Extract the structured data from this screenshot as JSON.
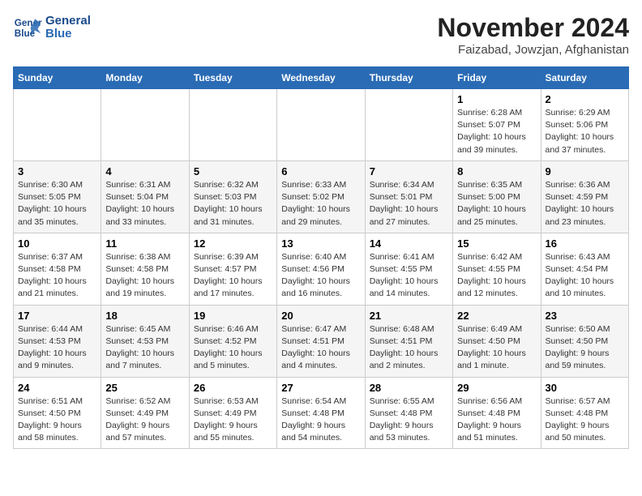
{
  "logo": {
    "line1": "General",
    "line2": "Blue"
  },
  "title": "November 2024",
  "subtitle": "Faizabad, Jowzjan, Afghanistan",
  "weekdays": [
    "Sunday",
    "Monday",
    "Tuesday",
    "Wednesday",
    "Thursday",
    "Friday",
    "Saturday"
  ],
  "weeks": [
    [
      {
        "day": "",
        "info": ""
      },
      {
        "day": "",
        "info": ""
      },
      {
        "day": "",
        "info": ""
      },
      {
        "day": "",
        "info": ""
      },
      {
        "day": "",
        "info": ""
      },
      {
        "day": "1",
        "info": "Sunrise: 6:28 AM\nSunset: 5:07 PM\nDaylight: 10 hours\nand 39 minutes."
      },
      {
        "day": "2",
        "info": "Sunrise: 6:29 AM\nSunset: 5:06 PM\nDaylight: 10 hours\nand 37 minutes."
      }
    ],
    [
      {
        "day": "3",
        "info": "Sunrise: 6:30 AM\nSunset: 5:05 PM\nDaylight: 10 hours\nand 35 minutes."
      },
      {
        "day": "4",
        "info": "Sunrise: 6:31 AM\nSunset: 5:04 PM\nDaylight: 10 hours\nand 33 minutes."
      },
      {
        "day": "5",
        "info": "Sunrise: 6:32 AM\nSunset: 5:03 PM\nDaylight: 10 hours\nand 31 minutes."
      },
      {
        "day": "6",
        "info": "Sunrise: 6:33 AM\nSunset: 5:02 PM\nDaylight: 10 hours\nand 29 minutes."
      },
      {
        "day": "7",
        "info": "Sunrise: 6:34 AM\nSunset: 5:01 PM\nDaylight: 10 hours\nand 27 minutes."
      },
      {
        "day": "8",
        "info": "Sunrise: 6:35 AM\nSunset: 5:00 PM\nDaylight: 10 hours\nand 25 minutes."
      },
      {
        "day": "9",
        "info": "Sunrise: 6:36 AM\nSunset: 4:59 PM\nDaylight: 10 hours\nand 23 minutes."
      }
    ],
    [
      {
        "day": "10",
        "info": "Sunrise: 6:37 AM\nSunset: 4:58 PM\nDaylight: 10 hours\nand 21 minutes."
      },
      {
        "day": "11",
        "info": "Sunrise: 6:38 AM\nSunset: 4:58 PM\nDaylight: 10 hours\nand 19 minutes."
      },
      {
        "day": "12",
        "info": "Sunrise: 6:39 AM\nSunset: 4:57 PM\nDaylight: 10 hours\nand 17 minutes."
      },
      {
        "day": "13",
        "info": "Sunrise: 6:40 AM\nSunset: 4:56 PM\nDaylight: 10 hours\nand 16 minutes."
      },
      {
        "day": "14",
        "info": "Sunrise: 6:41 AM\nSunset: 4:55 PM\nDaylight: 10 hours\nand 14 minutes."
      },
      {
        "day": "15",
        "info": "Sunrise: 6:42 AM\nSunset: 4:55 PM\nDaylight: 10 hours\nand 12 minutes."
      },
      {
        "day": "16",
        "info": "Sunrise: 6:43 AM\nSunset: 4:54 PM\nDaylight: 10 hours\nand 10 minutes."
      }
    ],
    [
      {
        "day": "17",
        "info": "Sunrise: 6:44 AM\nSunset: 4:53 PM\nDaylight: 10 hours\nand 9 minutes."
      },
      {
        "day": "18",
        "info": "Sunrise: 6:45 AM\nSunset: 4:53 PM\nDaylight: 10 hours\nand 7 minutes."
      },
      {
        "day": "19",
        "info": "Sunrise: 6:46 AM\nSunset: 4:52 PM\nDaylight: 10 hours\nand 5 minutes."
      },
      {
        "day": "20",
        "info": "Sunrise: 6:47 AM\nSunset: 4:51 PM\nDaylight: 10 hours\nand 4 minutes."
      },
      {
        "day": "21",
        "info": "Sunrise: 6:48 AM\nSunset: 4:51 PM\nDaylight: 10 hours\nand 2 minutes."
      },
      {
        "day": "22",
        "info": "Sunrise: 6:49 AM\nSunset: 4:50 PM\nDaylight: 10 hours\nand 1 minute."
      },
      {
        "day": "23",
        "info": "Sunrise: 6:50 AM\nSunset: 4:50 PM\nDaylight: 9 hours\nand 59 minutes."
      }
    ],
    [
      {
        "day": "24",
        "info": "Sunrise: 6:51 AM\nSunset: 4:50 PM\nDaylight: 9 hours\nand 58 minutes."
      },
      {
        "day": "25",
        "info": "Sunrise: 6:52 AM\nSunset: 4:49 PM\nDaylight: 9 hours\nand 57 minutes."
      },
      {
        "day": "26",
        "info": "Sunrise: 6:53 AM\nSunset: 4:49 PM\nDaylight: 9 hours\nand 55 minutes."
      },
      {
        "day": "27",
        "info": "Sunrise: 6:54 AM\nSunset: 4:48 PM\nDaylight: 9 hours\nand 54 minutes."
      },
      {
        "day": "28",
        "info": "Sunrise: 6:55 AM\nSunset: 4:48 PM\nDaylight: 9 hours\nand 53 minutes."
      },
      {
        "day": "29",
        "info": "Sunrise: 6:56 AM\nSunset: 4:48 PM\nDaylight: 9 hours\nand 51 minutes."
      },
      {
        "day": "30",
        "info": "Sunrise: 6:57 AM\nSunset: 4:48 PM\nDaylight: 9 hours\nand 50 minutes."
      }
    ]
  ]
}
